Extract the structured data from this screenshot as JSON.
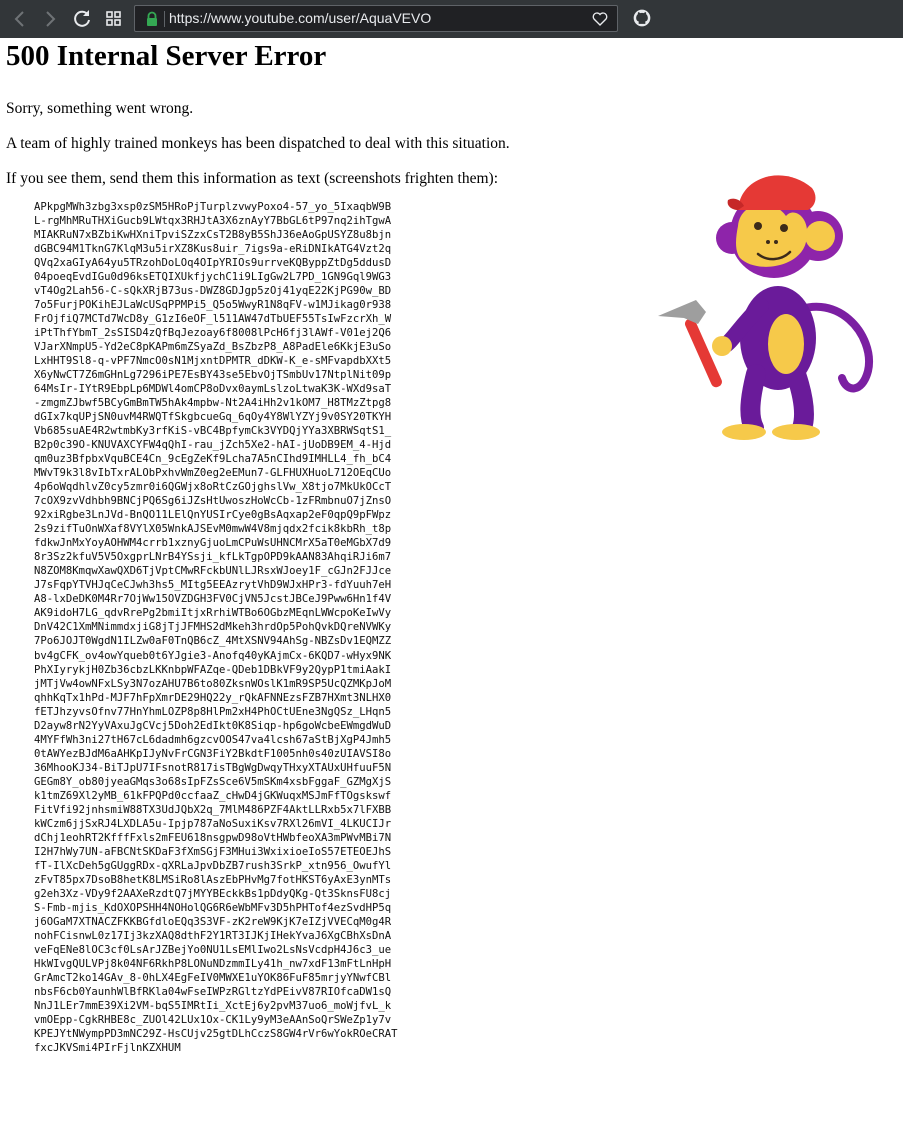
{
  "browser": {
    "url": "https://www.youtube.com/user/AquaVEVO",
    "icons": [
      "back-arrow-icon",
      "forward-arrow-icon",
      "reload-icon",
      "apps-grid-icon",
      "lock-icon",
      "heart-icon",
      "github-icon"
    ],
    "colors": {
      "toolbar": "#323639",
      "lock": "#34a853"
    }
  },
  "page": {
    "heading": "500 Internal Server Error",
    "line1": "Sorry, something went wrong.",
    "line2": "A team of highly trained monkeys has been dispatched to deal with this situation.",
    "line3": "If you see them, send them this information as text (screenshots frighten them):",
    "error_dump": "APkpgMWh3zbg3xsp0zSM5HRoPjTurplzvwyPoxo4-57_yo_5IxaqbW9B\nL-rgMhMRuTHXiGucb9LWtqx3RHJtA3X6znAyY7BbGL6tP97nq2ihTgwA\nMIAKRuN7xBZbiKwHXniTpviSZzxCsT2B8yB5ShJ36eAoGpUSYZ8u8bjn\ndGBC94M1TknG7KlqM3u5irXZ8Kus8uir_7igs9a-eRiDNIkATG4Vzt2q\nQVq2xaGIyA64yu5TRzohDoLOq4OIpYRIOs9urrveKQByppZtDg5ddusD\n04poeqEvdIGu0d96ksETQIXUkfjychC1i9LIgGw2L7PD_1GN9Gql9WG3\nvT4Og2Lah56-C-sQkXRjB73us-DWZ8GDJgp5zOj41yqE22KjPG90w_BD\n7o5FurjPOKihEJLaWcUSqPPMPi5_Q5o5WwyR1N8qFV-w1MJikag0r938\nFrOjfiQ7MCTd7WcD8y_G1zI6eOF_l511AW47dTbUEF55TsIwFzcrXh_W\niPtThfYbmT_2sSISD4zQfBqJezoay6f8008lPcH6fj3lAWf-V01ej2Q6\nVJarXNmpU5-Yd2eC8pKAPm6mZSyaZd_BsZbzP8_A8PadEle6KkjE3uSo\nLxHHT9Sl8-q-vPF7NmcO0sN1MjxntDPMTR_dDKW-K_e-sMFvapdbXXt5\nX6yNwCT7Z6mGHnLg7296iPE7EsBY43se5EbvOjTSmbUv17NtplNit09p\n64MsIr-IYtR9EbpLp6MDWl4omCP8oDvx0aymLslzoLtwaK3K-WXd9saT\n-zmgmZJbwf5BCyGmBmTW5hAk4mpbw-Nt2A4iHh2v1kOM7_H8TMzZtpg8\ndGIx7kqUPjSN0uvM4RWQTfSkgbcueGq_6qOy4Y8WlYZYj9v0SY20TKYH\nVb685suAE4R2wtmbKy3rfKiS-vBC4BpfymCk3VYDQjYYa3XBRWSqtS1_\nB2p0c39O-KNUVAXCYFW4qQhI-rau_jZch5Xe2-hAI-jUoDB9EM_4-Hjd\nqm0uz3BfpbxVquBCE4Cn_9cEgZeKf9Lcha7A5nCIhd9IMHLL4_fh_bC4\nMWvT9k3l8vIbTxrALObPxhvWmZ0eg2eEMun7-GLFHUXHuoL712OEqCUo\n4p6oWqdhlvZ0cy5zmr0i6QGWjx8oRtCzGOjghslVw_X8tjo7MkUkOCcT\n7cOX9zvVdhbh9BNCjPQ6Sg6iJZsHtUwoszHoWcCb-1zFRmbnuO7jZnsO\n92xiRgbe3LnJVd-BnQO11LElQnYUSIrCye0gBsAqxap2eF0qpQ9pFWpz\n2s9zifTuOnWXaf8VYlX05WnkAJSEvM0mwW4V8mjqdx2fcik8kbRh_t8p\nfdkwJnMxYoyAOHWM4crrb1xznyGjuoLmCPuWsUHNCMrX5aT0eMGbX7d9\n8r3Sz2kfuV5V5OxgprLNrB4YSsji_kfLkTgpOPD9kAAN83AhqiRJi6m7\nN8ZOM8KmqwXawQXD6TjVptCMwRFckbUNlLJRsxWJoey1F_cGJn2FJJce\nJ7sFqpYTVHJqCeCJwh3hs5_MItg5EEAzrytVhD9WJxHPr3-fdYuuh7eH\nA8-lxDeDK0M4Rr7OjWw15OVZDGH3FV0CjVN5JcstJBCeJ9Pww6Hn1f4V\nAK9idoH7LG_qdvRrePg2bmiItjxRrhiWTBo6OGbzMEqnLWWcpoKeIwVy\nDnV42C1XmMNimmdxjiG8jTjJFMHS2dMkeh3hrdOp5PohQvkDQreNVWKy\n7Po6JOJT0WgdN1ILZw0aF0TnQB6cZ_4MtXSNV94AhSg-NBZsDv1EQMZZ\nbv4gCFK_ov4owYqueb0t6YJgie3-Anofq40yKAjmCx-6KQD7-wHyx9NK\nPhXIyrykjH0Zb36cbzLKKnbpWFAZqe-QDeb1DBkVF9y2QypP1tmiAakI\njMTjVw4owNFxLSy3N7ozAHU7B6to80ZksnWOslK1mR9SP5UcQZMKpJoM\nqhhKqTx1hPd-MJF7hFpXmrDE29HQ22y_rQkAFNNEzsFZB7HXmt3NLHX0\nfETJhzyvsOfnv77HnYhmLOZP8p8HlPm2xH4PhOCtUEne3NgQSz_LHqn5\nD2ayw8rN2YyVAxuJgCVcj5Doh2EdIkt0K8Siqp-hp6goWcbeEWmgdWuD\n4MYFfWh3ni27tH67cL6dadmh6gzcvOOS47va4lcsh67aStBjXgP4Jmh5\n0tAWYezBJdM6aAHKpIJyNvFrCGN3FiY2BkdtF1005nh0s40zUIAVSI8o\n36MhooKJ34-BiTJpU7IFsnotR817isTBgWgDwqyTHxyXTAUxUHfuuF5N\nGEGm8Y_ob80jyeaGMqs3o68sIpFZsSce6V5mSKm4xsbFggaF_GZMgXjS\nk1tmZ69Xl2yMB_61kFPQPd0ccfaaZ_cHwD4jGKWuqxMSJmFfTOgskswf\nFitVfi92jnhsmiW88TX3UdJQbX2q_7MlM486PZF4AktLLRxb5x7lFXBB\nkWCzm6jjSxRJ4LXDLA5u-Ipjp787aNoSuxiKsv7RXl26mVI_4LKUCIJr\ndChj1eohRT2KfffFxls2mFEU618nsgpwD98oVtHWbfeoXA3mPWvMBi7N\nI2H7hWy7UN-aFBCNtSKDaF3fXmSGjF3MHui3WxixioeIoS57ETEOEJhS\nfT-IlXcDeh5gGUggRDx-qXRLaJpvDbZB7rush3SrkP_xtn956_OwufYl\nzFvT85px7DsoB8hetK8LMSiRo8lAszEbPHvMg7fotHKST6yAxE3ynMTs\ng2eh3Xz-VDy9f2AAXeRzdtQ7jMYYBEckkBs1pDdyQKg-Qt3SknsFU8cj\nS-Fmb-mjis_KdOXOPSHH4NOHolQG6R6eWbMFv3D5hPHTof4ezSvdHP5q\nj6OGaM7XTNACZFKKBGfdloEQq3S3VF-zK2reW9KjK7eIZjVVECqM0g4R\nnohFCisnwL0z17Ij3kzXAQ8dthF2Y1RT3IJKjIHekYvaJ6XgCBhXsDnA\nveFqENe8lOC3cf0LsArJZBejYo0NU1LsEMlIwo2LsNsVcdpH4J6c3_ue\nHkWIvgQULVPj8k04NF6RkhP8LONuNDzmmILy41h_nw7xdF13mFtLnHpH\nGrAmcT2ko14GAv_8-0hLX4EgFeIV0MWXE1uYOK86FuF85mrjyYNwfCBl\nnbsF6cb0YaunhWlBfRKla04wFseIWPzRGltzYdPEivV87RIOfcaDW1sQ\nNnJ1LEr7mmE39Xi2VM-bqS5IMRtIi_XctEj6y2pvM37uo6_moWjfvL_k\nvmOEpp-CgkRHBE8c_ZUOl42LUx1Ox-CK1Ly9yM3eAAnSoQrSWeZp1y7v\nKPEJYtNWympPD3mNC29Z-HsCUjv25gtDLhCczS8GW4rVr6wYokROeCRAT\nfxcJKVSmi4PIrFjlnKZXHUM"
  },
  "illustration": {
    "name": "monkey-with-hammer",
    "colors": {
      "body": "#6a1b9a",
      "body_light": "#8e24aa",
      "face": "#f6c94a",
      "cap": "#e53935",
      "hammer_head": "#9e9e9e",
      "hammer_handle": "#e53935"
    }
  }
}
